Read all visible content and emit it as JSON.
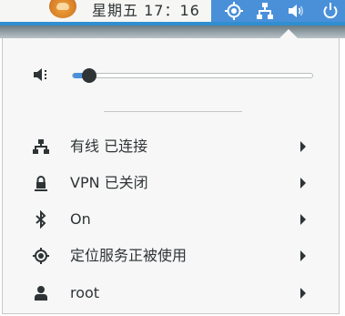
{
  "topbar": {
    "app_icon": "fire-app-icon",
    "clock": "星期五 17：16",
    "system_icons": [
      "location-icon",
      "network-wired-icon",
      "volume-icon",
      "power-icon"
    ],
    "accent_color": "#4a90d9"
  },
  "menu": {
    "volume": {
      "icon": "volume-muted-icon",
      "level": 0.07
    },
    "items": [
      {
        "icon": "network-wired-icon",
        "label": "有线 已连接"
      },
      {
        "icon": "vpn-lock-icon",
        "label": "VPN 已关闭"
      },
      {
        "icon": "bluetooth-icon",
        "label": "On"
      },
      {
        "icon": "location-icon",
        "label": "定位服务正被使用"
      },
      {
        "icon": "user-icon",
        "label": "root"
      }
    ]
  }
}
